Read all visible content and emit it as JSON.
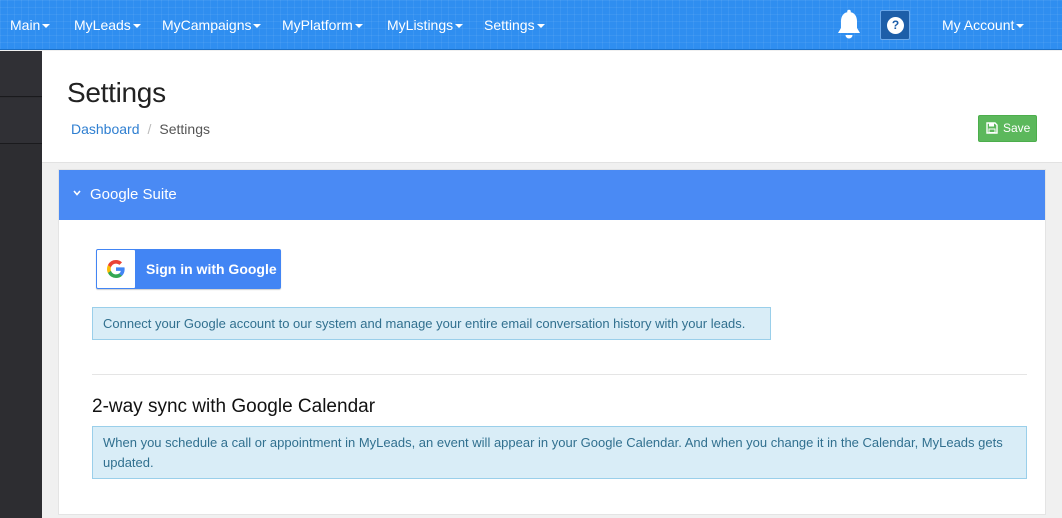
{
  "nav": {
    "main": "Main",
    "myleads": "MyLeads",
    "mycampaigns": "MyCampaigns",
    "myplatform": "MyPlatform",
    "mylistings": "MyListings",
    "settings": "Settings",
    "my_account": "My Account",
    "help_glyph": "?",
    "bell_icon": "bell-icon",
    "help_icon": "question-circle-icon"
  },
  "header": {
    "title": "Settings",
    "breadcrumb": {
      "dashboard": "Dashboard",
      "separator": "/",
      "current": "Settings"
    },
    "save_label": "Save"
  },
  "panel": {
    "title": "Google Suite",
    "google_button_label": "Sign in with Google",
    "connect_info": "Connect your Google account to our system and manage your entire email conversation history with your leads.",
    "calendar_heading": "2-way sync with Google Calendar",
    "calendar_info": "When you schedule a call or appointment in MyLeads, an event will appear in your Google Calendar. And when you change it in the Calendar, MyLeads gets updated."
  },
  "colors": {
    "nav_bg": "#2f8ef0",
    "panel_head": "#4a8af4",
    "save_green": "#5cb85c",
    "info_bg": "#d9edf7",
    "info_text": "#31708f"
  }
}
